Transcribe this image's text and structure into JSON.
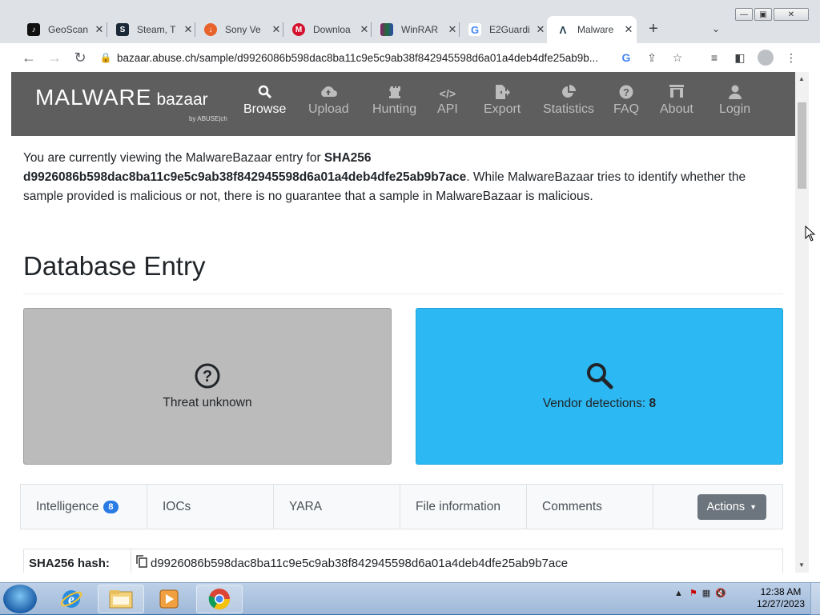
{
  "browser": {
    "tabs": [
      {
        "title": "GeoScan",
        "favicon_color": "#111111",
        "favicon_glyph": "♪"
      },
      {
        "title": "Steam, T",
        "favicon_color": "#1b2838",
        "favicon_glyph": "S"
      },
      {
        "title": "Sony Ve",
        "favicon_color": "#e8622c",
        "favicon_glyph": "↓"
      },
      {
        "title": "Downloa",
        "favicon_color": "#d4122f",
        "favicon_glyph": "M"
      },
      {
        "title": "WinRAR",
        "favicon_color": "#8b1b6e",
        "favicon_glyph": "W"
      },
      {
        "title": "E2Guardi",
        "favicon_color": "#4285f4",
        "favicon_glyph": "G"
      },
      {
        "title": "Malware",
        "favicon_color": "#17a2b8",
        "favicon_glyph": "Λ"
      }
    ],
    "new_tab_glyph": "+",
    "url": "bazaar.abuse.ch/sample/d9926086b598dac8ba11c9e5c9ab38f842945598d6a01a4deb4dfe25ab9b..."
  },
  "nav": {
    "logo_main": "MALWARE",
    "logo_sub": "bazaar",
    "logo_by": "by ABUSE|ch",
    "items": [
      {
        "label": "Browse",
        "icon": "search-icon",
        "glyph": "🔍"
      },
      {
        "label": "Upload",
        "icon": "cloud-upload-icon",
        "glyph": "☁"
      },
      {
        "label": "Hunting",
        "icon": "chess-rook-icon",
        "glyph": "♜"
      },
      {
        "label": "API",
        "icon": "code-icon",
        "glyph": "</>"
      },
      {
        "label": "Export",
        "icon": "file-export-icon",
        "glyph": "⇨"
      },
      {
        "label": "Statistics",
        "icon": "pie-chart-icon",
        "glyph": "◕"
      },
      {
        "label": "FAQ",
        "icon": "question-circle-icon",
        "glyph": "?"
      },
      {
        "label": "About",
        "icon": "building-icon",
        "glyph": "⌂"
      },
      {
        "label": "Login",
        "icon": "user-icon",
        "glyph": "●"
      }
    ]
  },
  "intro": {
    "prefix": "You are currently viewing the MalwareBazaar entry for ",
    "sha_label": "SHA256",
    "sha": "d9926086b598dac8ba11c9e5c9ab38f842945598d6a01a4deb4dfe25ab9b7ace",
    "suffix": ". While MalwareBazaar tries to identify whether the sample provided is malicious or not, there is no guarantee that a sample in MalwareBazaar is malicious."
  },
  "db_title": "Database Entry",
  "cards": {
    "threat_label": "Threat unknown",
    "vendor_label": "Vendor detections: ",
    "vendor_count": "8"
  },
  "page_tabs": {
    "items": [
      "Intelligence",
      "IOCs",
      "YARA",
      "File information",
      "Comments"
    ],
    "intel_badge": "8",
    "actions_label": "Actions"
  },
  "hash_row": {
    "label": "SHA256 hash:",
    "value": "d9926086b598dac8ba11c9e5c9ab38f842945598d6a01a4deb4dfe25ab9b7ace"
  },
  "taskbar": {
    "time": "12:38 AM",
    "date": "12/27/2023"
  }
}
